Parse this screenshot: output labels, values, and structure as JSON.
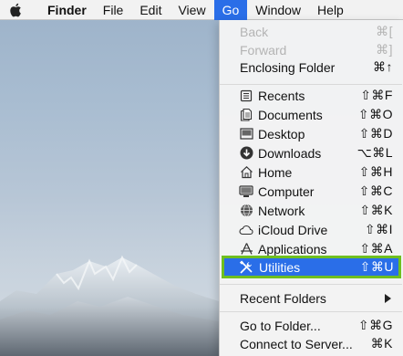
{
  "menubar": {
    "apple_icon": "apple-icon",
    "items": [
      {
        "label": "Finder"
      },
      {
        "label": "File"
      },
      {
        "label": "Edit"
      },
      {
        "label": "View"
      },
      {
        "label": "Go"
      },
      {
        "label": "Window"
      },
      {
        "label": "Help"
      }
    ]
  },
  "go_menu": {
    "back": {
      "label": "Back",
      "shortcut": "⌘["
    },
    "forward": {
      "label": "Forward",
      "shortcut": "⌘]"
    },
    "enclosing_folder": {
      "label": "Enclosing Folder",
      "shortcut": "⌘↑"
    },
    "places": [
      {
        "label": "Recents",
        "shortcut": "⇧⌘F",
        "icon": "recents-icon"
      },
      {
        "label": "Documents",
        "shortcut": "⇧⌘O",
        "icon": "documents-icon"
      },
      {
        "label": "Desktop",
        "shortcut": "⇧⌘D",
        "icon": "desktop-icon"
      },
      {
        "label": "Downloads",
        "shortcut": "⌥⌘L",
        "icon": "downloads-icon"
      },
      {
        "label": "Home",
        "shortcut": "⇧⌘H",
        "icon": "home-icon"
      },
      {
        "label": "Computer",
        "shortcut": "⇧⌘C",
        "icon": "computer-icon"
      },
      {
        "label": "Network",
        "shortcut": "⇧⌘K",
        "icon": "network-icon"
      },
      {
        "label": "iCloud Drive",
        "shortcut": "⇧⌘I",
        "icon": "icloud-icon"
      },
      {
        "label": "Applications",
        "shortcut": "⇧⌘A",
        "icon": "applications-icon"
      },
      {
        "label": "Utilities",
        "shortcut": "⇧⌘U",
        "icon": "utilities-icon"
      }
    ],
    "recent_folders": {
      "label": "Recent Folders"
    },
    "go_to_folder": {
      "label": "Go to Folder...",
      "shortcut": "⇧⌘G"
    },
    "connect_to_server": {
      "label": "Connect to Server...",
      "shortcut": "⌘K"
    }
  },
  "colors": {
    "highlight": "#2a6ee8",
    "annotation_border": "#6fbf1f"
  }
}
